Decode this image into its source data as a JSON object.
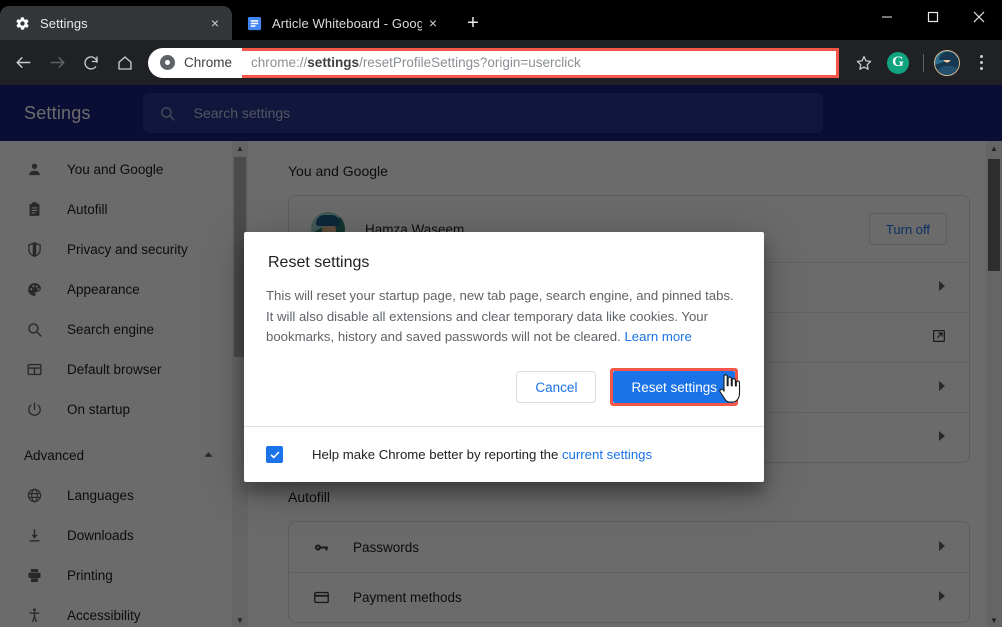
{
  "window": {
    "minimize_label": "Minimize",
    "maximize_label": "Maximize",
    "close_label": "Close"
  },
  "tabs": [
    {
      "title": "Settings",
      "favicon": "gear-icon",
      "active": true,
      "close_label": "×"
    },
    {
      "title": "Article Whiteboard - Google Doc",
      "favicon": "google-docs-icon",
      "active": false,
      "close_label": "×"
    }
  ],
  "newtab_label": "+",
  "toolbar": {
    "back_label": "←",
    "forward_label": "→",
    "reload_label": "⟳",
    "home_label": "⌂",
    "chip_label": "Chrome",
    "url_prefix": "chrome://",
    "url_bold": "settings",
    "url_suffix": "/resetProfileSettings?origin=userclick",
    "url_full": "chrome://settings/resetProfileSettings?origin=userclick",
    "bookmark_label": "☆",
    "extension_label": "G",
    "menu_label": "⋮",
    "highlight_color": "#f4564a"
  },
  "settings": {
    "title": "Settings",
    "search_placeholder": "Search settings",
    "header_color": "#1a237e",
    "sidebar": [
      {
        "label": "You and Google",
        "icon": "person-icon"
      },
      {
        "label": "Autofill",
        "icon": "clipboard-icon"
      },
      {
        "label": "Privacy and security",
        "icon": "shield-icon"
      },
      {
        "label": "Appearance",
        "icon": "palette-icon"
      },
      {
        "label": "Search engine",
        "icon": "search-icon"
      },
      {
        "label": "Default browser",
        "icon": "browser-window-icon"
      },
      {
        "label": "On startup",
        "icon": "power-icon"
      }
    ],
    "advanced_label": "Advanced",
    "advanced_expanded": true,
    "sidebar_advanced": [
      {
        "label": "Languages",
        "icon": "globe-icon"
      },
      {
        "label": "Downloads",
        "icon": "download-icon"
      },
      {
        "label": "Printing",
        "icon": "printer-icon"
      },
      {
        "label": "Accessibility",
        "icon": "accessibility-icon"
      }
    ],
    "sections": [
      {
        "title": "You and Google",
        "profile": {
          "name": "Hamza Waseem",
          "action_label": "Turn off"
        },
        "rows": [
          {
            "label": "",
            "trailing": "chevron-right-icon"
          },
          {
            "label": "",
            "trailing": "external-link-icon"
          },
          {
            "label": "",
            "trailing": "chevron-right-icon"
          },
          {
            "label": "",
            "trailing": "chevron-right-icon"
          }
        ]
      },
      {
        "title": "Autofill",
        "rows": [
          {
            "label": "Passwords",
            "icon": "key-icon",
            "trailing": "chevron-right-icon"
          },
          {
            "label": "Payment methods",
            "icon": "credit-card-icon",
            "trailing": "chevron-right-icon"
          }
        ]
      }
    ]
  },
  "dialog": {
    "title": "Reset settings",
    "body_text": "This will reset your startup page, new tab page, search engine, and pinned tabs. It will also disable all extensions and clear temporary data like cookies. Your bookmarks, history and saved passwords will not be cleared. ",
    "learn_more": "Learn more",
    "cancel_label": "Cancel",
    "confirm_label": "Reset settings",
    "footer_text": "Help make Chrome better by reporting the ",
    "footer_link": "current settings",
    "checkbox_checked": true,
    "primary_color": "#1a73e8",
    "highlight_color": "#f4564a"
  }
}
